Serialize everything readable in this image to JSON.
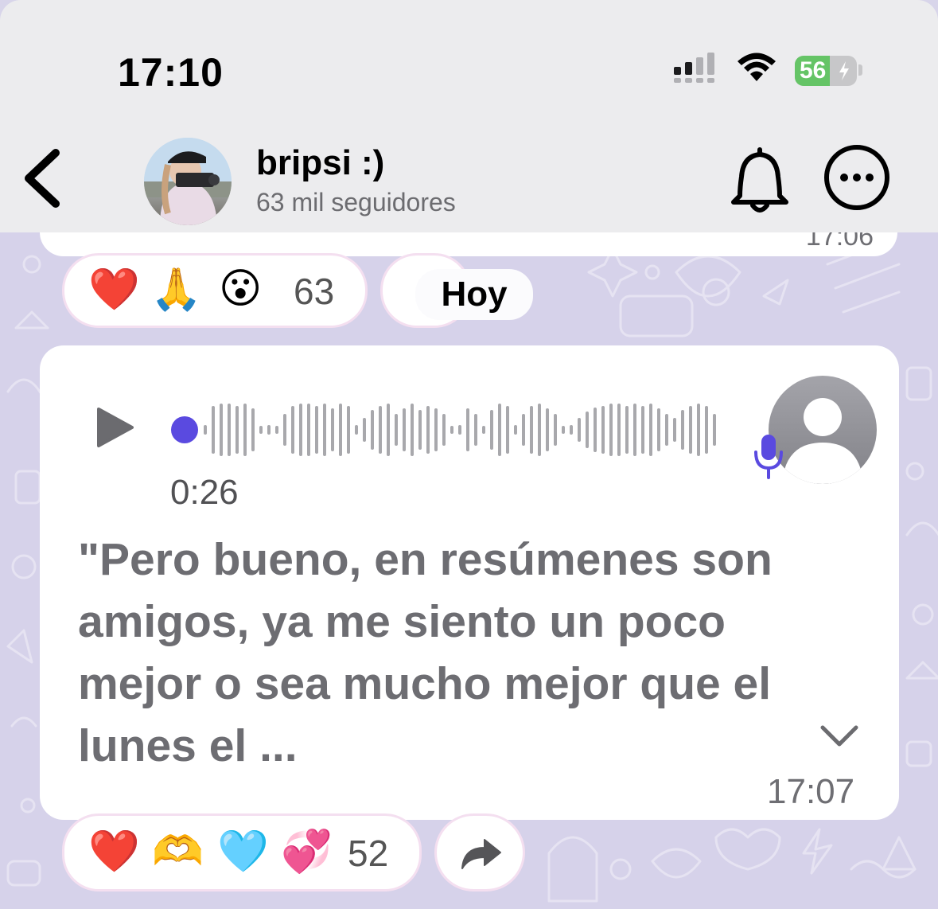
{
  "status_bar": {
    "time": "17:10",
    "battery_percent": "56",
    "battery_level": 0.56,
    "battery_charging": true,
    "icons": [
      "cellular-signal-icon",
      "wifi-icon",
      "battery-charging-icon"
    ]
  },
  "header": {
    "back_icon": "chevron-left-icon",
    "channel_name": "bripsi :)",
    "followers": "63 mil seguidores",
    "bell_icon": "bell-icon",
    "more_icon": "ellipsis-circle-icon"
  },
  "previous_message": {
    "time": "17:06"
  },
  "previous_reactions": {
    "emojis": [
      "❤️",
      "🙏",
      "😮"
    ],
    "count": "63"
  },
  "date_separator": "Hoy",
  "voice_message": {
    "duration": "0:26",
    "played_fraction": 0,
    "transcript": "\"Pero bueno, en resúmenes son amigos, ya me siento un poco mejor o sea mucho mejor que el lunes el ...",
    "time": "17:07",
    "accent_color": "#5a4ae0"
  },
  "reactions": {
    "emojis": [
      "❤️",
      "🫶",
      "🩵",
      "💞"
    ],
    "count": "52",
    "share_icon": "share-arrow-icon"
  }
}
